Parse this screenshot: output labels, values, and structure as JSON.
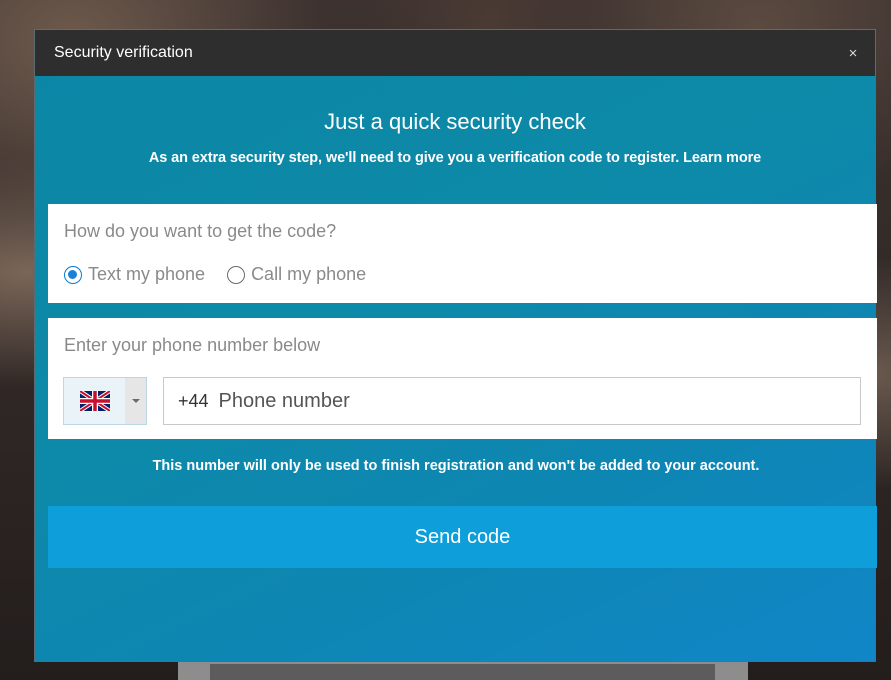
{
  "dialog": {
    "title": "Security verification",
    "close_symbol": "×"
  },
  "content": {
    "heading": "Just a quick security check",
    "description": "As an extra security step, we'll need to give you a verification code to register.",
    "learn_more": "Learn more"
  },
  "method": {
    "question": "How do you want to get the code?",
    "options": [
      {
        "label": "Text my phone",
        "selected": true
      },
      {
        "label": "Call my phone",
        "selected": false
      }
    ]
  },
  "phone": {
    "label": "Enter your phone number below",
    "country_flag": "uk-flag-icon",
    "dial_code": "+44",
    "placeholder": "Phone number",
    "value": ""
  },
  "note": "This number will only be used to finish registration and won't be added to your account.",
  "send_button": "Send code",
  "colors": {
    "titlebar": "#2e2e2e",
    "modal_teal": "#0c86a5",
    "send_button": "#0e9ed9",
    "radio_selected": "#1a82d6"
  }
}
